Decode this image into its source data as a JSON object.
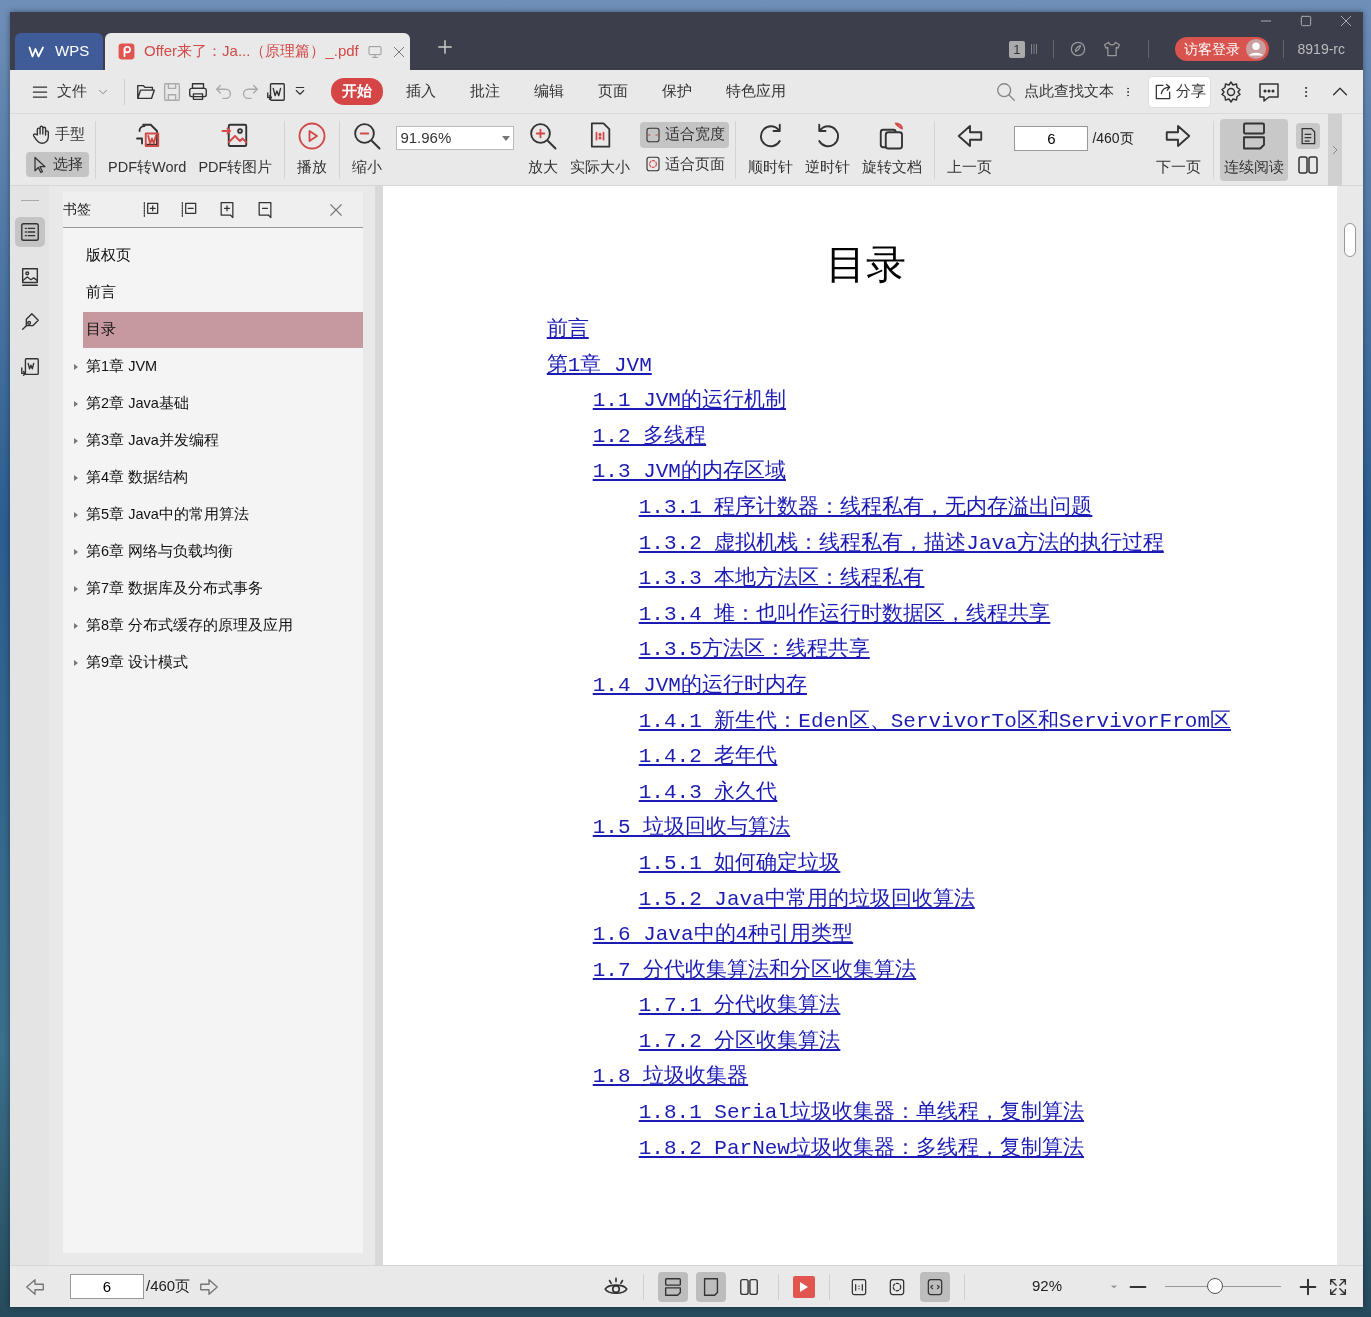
{
  "tabs": [
    {
      "kind": "home",
      "label": "WPS",
      "selected": false
    },
    {
      "kind": "document",
      "label": "Offer来了：Ja...（原理篇）_.pdf",
      "selected": true
    }
  ],
  "title_bar": {
    "window_count": "1",
    "login_button": "访客登录",
    "user": "8919-rc"
  },
  "menu": {
    "file": "文件",
    "tabs": [
      {
        "label": "开始",
        "selected": true
      },
      {
        "label": "插入",
        "selected": false
      },
      {
        "label": "批注",
        "selected": false
      },
      {
        "label": "编辑",
        "selected": false
      },
      {
        "label": "页面",
        "selected": false
      },
      {
        "label": "保护",
        "selected": false
      },
      {
        "label": "特色应用",
        "selected": false
      }
    ],
    "search": "点此查找文本",
    "share": "分享"
  },
  "toolbar": {
    "pointer_tools": [
      {
        "label": "手型",
        "selected": false
      },
      {
        "label": "选择",
        "selected": true
      }
    ],
    "convert": [
      "PDF转Word",
      "PDF转图片"
    ],
    "play": "播放",
    "zoom_out": "缩小",
    "zoom_value": "91.96%",
    "zoom_in": "放大",
    "actual_size": "实际大小",
    "fit_modes": [
      {
        "label": "适合宽度",
        "selected": true
      },
      {
        "label": "适合页面",
        "selected": false
      }
    ],
    "rotate": [
      "顺时针",
      "逆时针",
      "旋转文档"
    ],
    "prev_page": "上一页",
    "page_input": "6",
    "page_total": "/460页",
    "next_page": "下一页",
    "continuous_reading": {
      "label": "连续阅读",
      "selected": true
    }
  },
  "side_rail": [
    {
      "selected": true
    },
    {
      "selected": false
    },
    {
      "selected": false
    },
    {
      "selected": false
    }
  ],
  "bookmarks": {
    "title": "书签",
    "items": [
      {
        "label": "版权页",
        "selected": false
      },
      {
        "label": "前言",
        "selected": false
      },
      {
        "label": "目录",
        "selected": true
      },
      {
        "label": "第1章 JVM",
        "selected": false,
        "expanded": false
      },
      {
        "label": "第2章 Java基础",
        "selected": false,
        "expanded": false
      },
      {
        "label": "第3章 Java并发编程",
        "selected": false,
        "expanded": false
      },
      {
        "label": "第4章 数据结构",
        "selected": false,
        "expanded": false
      },
      {
        "label": "第5章 Java中的常用算法",
        "selected": false,
        "expanded": false
      },
      {
        "label": "第6章 网络与负载均衡",
        "selected": false,
        "expanded": false
      },
      {
        "label": "第7章 数据库及分布式事务",
        "selected": false,
        "expanded": false
      },
      {
        "label": "第8章 分布式缓存的原理及应用",
        "selected": false,
        "expanded": false
      },
      {
        "label": "第9章 设计模式",
        "selected": false,
        "expanded": false
      }
    ]
  },
  "document": {
    "title": "目录",
    "toc": [
      {
        "label": "前言"
      },
      {
        "label": "第1章 JVM",
        "children": [
          {
            "label": "1.1 JVM的运行机制"
          },
          {
            "label": "1.2 多线程"
          },
          {
            "label": "1.3 JVM的内存区域",
            "children": [
              {
                "label": "1.3.1 程序计数器：线程私有，无内存溢出问题"
              },
              {
                "label": "1.3.2 虚拟机栈：线程私有，描述Java方法的执行过程"
              },
              {
                "label": "1.3.3 本地方法区：线程私有"
              },
              {
                "label": "1.3.4 堆：也叫作运行时数据区，线程共享"
              },
              {
                "label": "1.3.5方法区：线程共享"
              }
            ]
          },
          {
            "label": "1.4 JVM的运行时内存",
            "children": [
              {
                "label": "1.4.1 新生代：Eden区、ServivorTo区和ServivorFrom区"
              },
              {
                "label": "1.4.2 老年代"
              },
              {
                "label": "1.4.3 永久代"
              }
            ]
          },
          {
            "label": "1.5 垃圾回收与算法",
            "children": [
              {
                "label": "1.5.1 如何确定垃圾"
              },
              {
                "label": "1.5.2 Java中常用的垃圾回收算法"
              }
            ]
          },
          {
            "label": "1.6 Java中的4种引用类型"
          },
          {
            "label": "1.7 分代收集算法和分区收集算法",
            "children": [
              {
                "label": "1.7.1 分代收集算法"
              },
              {
                "label": "1.7.2 分区收集算法"
              }
            ]
          },
          {
            "label": "1.8 垃圾收集器",
            "children": [
              {
                "label": "1.8.1 Serial垃圾收集器：单线程，复制算法"
              },
              {
                "label": "1.8.2 ParNew垃圾收集器：多线程，复制算法"
              }
            ]
          }
        ]
      }
    ]
  },
  "status_bar": {
    "page_input": "6",
    "page_total": "/460页",
    "view_modes": [
      {
        "selected": true
      },
      {
        "selected": true
      },
      {
        "selected": false
      }
    ],
    "fit_modes": [
      {
        "selected": false
      },
      {
        "selected": false
      },
      {
        "selected": true
      }
    ],
    "zoom": "92%",
    "zoom_slider": {
      "level": 0.43
    }
  }
}
